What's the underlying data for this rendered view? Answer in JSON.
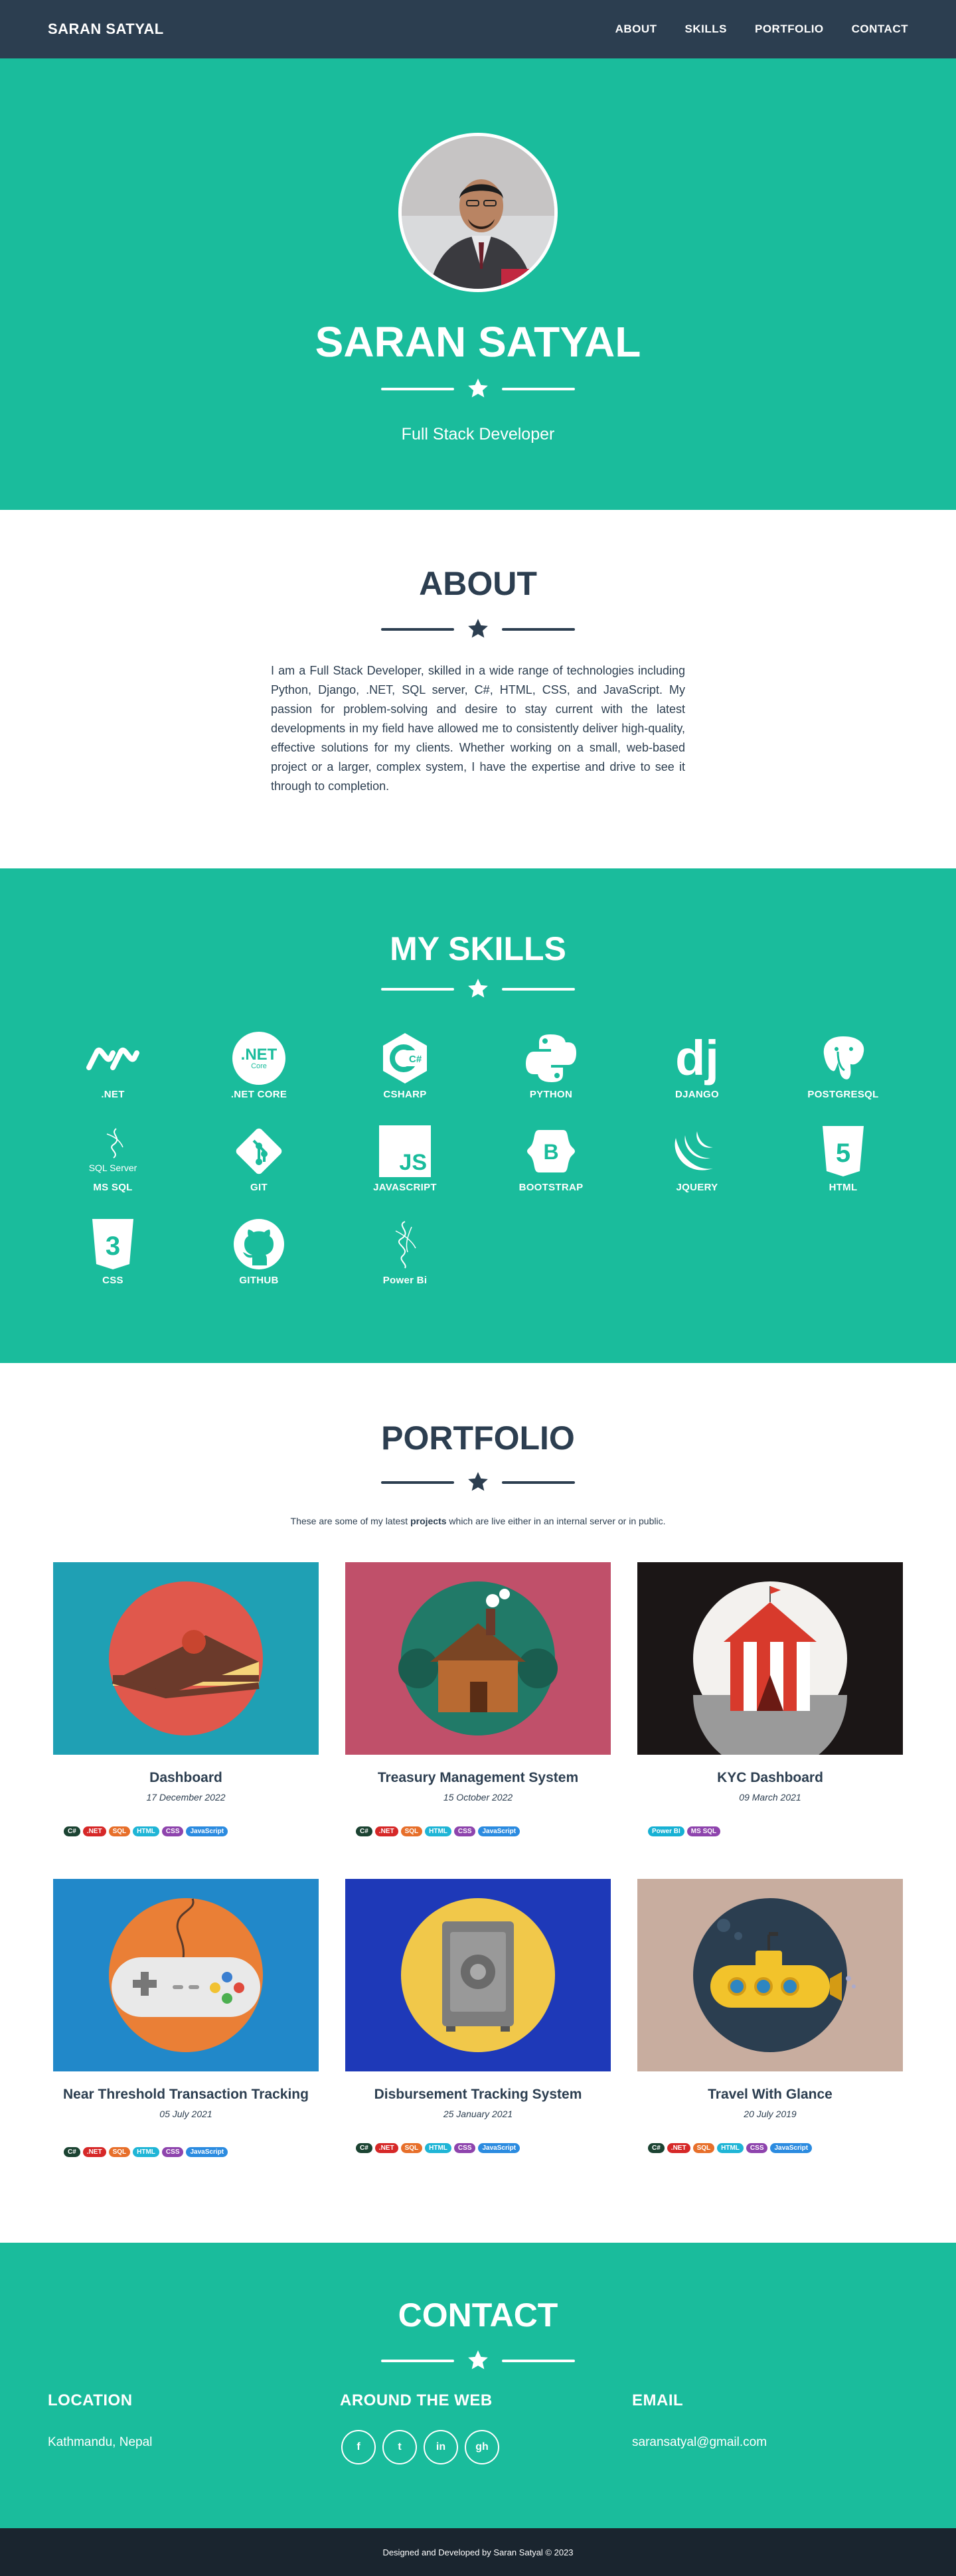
{
  "nav": {
    "brand": "SARAN SATYAL",
    "links": [
      "ABOUT",
      "SKILLS",
      "PORTFOLIO",
      "CONTACT"
    ]
  },
  "hero": {
    "name": "SARAN SATYAL",
    "subtitle": "Full Stack Developer"
  },
  "about": {
    "title": "ABOUT",
    "text": "I am a Full Stack Developer, skilled in a wide range of technologies including Python, Django, .NET, SQL server, C#, HTML, CSS, and JavaScript. My passion for problem-solving and desire to stay current with the latest developments in my field have allowed me to consistently deliver high-quality, effective solutions for my clients. Whether working on a small, web-based project or a larger, complex system, I have the expertise and drive to see it through to completion."
  },
  "skills": {
    "title": "MY SKILLS",
    "items": [
      {
        "label": ".NET",
        "icon": "dotnet-icon"
      },
      {
        "label": ".NET CORE",
        "icon": "dotnet-core-icon"
      },
      {
        "label": "CSHARP",
        "icon": "csharp-icon"
      },
      {
        "label": "PYTHON",
        "icon": "python-icon"
      },
      {
        "label": "DJANGO",
        "icon": "django-icon"
      },
      {
        "label": "POSTGRESQL",
        "icon": "postgresql-icon"
      },
      {
        "label": "MS SQL",
        "icon": "mssql-icon"
      },
      {
        "label": "GIT",
        "icon": "git-icon"
      },
      {
        "label": "JAVASCRIPT",
        "icon": "javascript-icon"
      },
      {
        "label": "BOOTSTRAP",
        "icon": "bootstrap-icon"
      },
      {
        "label": "JQUERY",
        "icon": "jquery-icon"
      },
      {
        "label": "HTML",
        "icon": "html5-icon"
      },
      {
        "label": "CSS",
        "icon": "css3-icon"
      },
      {
        "label": "GITHUB",
        "icon": "github-icon"
      },
      {
        "label": "Power Bi",
        "icon": "powerbi-icon"
      }
    ],
    "icon_texts": {
      "dotnet_core": ".NET",
      "core": "Core",
      "csharp": "C#",
      "django": "dj",
      "sql_server": "SQL Server",
      "js": "JS",
      "bootstrap": "B",
      "html": "5",
      "css": "3"
    }
  },
  "portfolio": {
    "title": "PORTFOLIO",
    "intro_pre": "These are some of my latest ",
    "intro_bold": "projects",
    "intro_post": " which are live either in an internal server or in public.",
    "projects": [
      {
        "title": "Dashboard",
        "date": "17 December 2022",
        "tags": [
          "C#",
          ".NET",
          "SQL",
          "HTML",
          "CSS",
          "JavaScript"
        ],
        "bg": "#1fa0b4",
        "icon": "cake-icon"
      },
      {
        "title": "Treasury Management System",
        "date": "15 October 2022",
        "tags": [
          "C#",
          ".NET",
          "SQL",
          "HTML",
          "CSS",
          "JavaScript"
        ],
        "bg": "#c0506a",
        "icon": "cabin-icon"
      },
      {
        "title": "KYC Dashboard",
        "date": "09 March 2021",
        "tags": [
          "Power BI",
          "MS SQL"
        ],
        "bg": "#1b1616",
        "icon": "circus-tent-icon"
      },
      {
        "title": "Near Threshold Transaction Tracking",
        "date": "05 July 2021",
        "tags": [
          "C#",
          ".NET",
          "SQL",
          "HTML",
          "CSS",
          "JavaScript"
        ],
        "bg": "#2188c9",
        "icon": "gamepad-icon"
      },
      {
        "title": "Disbursement Tracking System",
        "date": "25 January 2021",
        "tags": [
          "C#",
          ".NET",
          "SQL",
          "HTML",
          "CSS",
          "JavaScript"
        ],
        "bg": "#1e39b8",
        "icon": "safe-icon"
      },
      {
        "title": "Travel With Glance",
        "date": "20 July 2019",
        "tags": [
          "C#",
          ".NET",
          "SQL",
          "HTML",
          "CSS",
          "JavaScript"
        ],
        "bg": "#c8ad9f",
        "icon": "submarine-icon"
      }
    ],
    "tag_colors": {
      "C#": "#1b4332",
      ".NET": "#d62828",
      "SQL": "#e76f2a",
      "HTML": "#1fb5d6",
      "CSS": "#8e44ad",
      "JavaScript": "#2b8be0",
      "Power BI": "#17b1d4",
      "MS SQL": "#8e44ad"
    }
  },
  "contact": {
    "title": "CONTACT",
    "location_heading": "LOCATION",
    "location": "Kathmandu, Nepal",
    "web_heading": "AROUND THE WEB",
    "social": [
      {
        "glyph": "f",
        "icon": "facebook-icon"
      },
      {
        "glyph": "t",
        "icon": "twitter-icon"
      },
      {
        "glyph": "in",
        "icon": "linkedin-icon"
      },
      {
        "glyph": "gh",
        "icon": "github-icon"
      }
    ],
    "email_heading": "EMAIL",
    "email": "saransatyal@gmail.com"
  },
  "footer": {
    "text": "Designed and Developed by Saran Satyal © 2023"
  },
  "colors": {
    "primary": "#1abc9c",
    "dark": "#2c3e50",
    "footer": "#1a252f"
  }
}
